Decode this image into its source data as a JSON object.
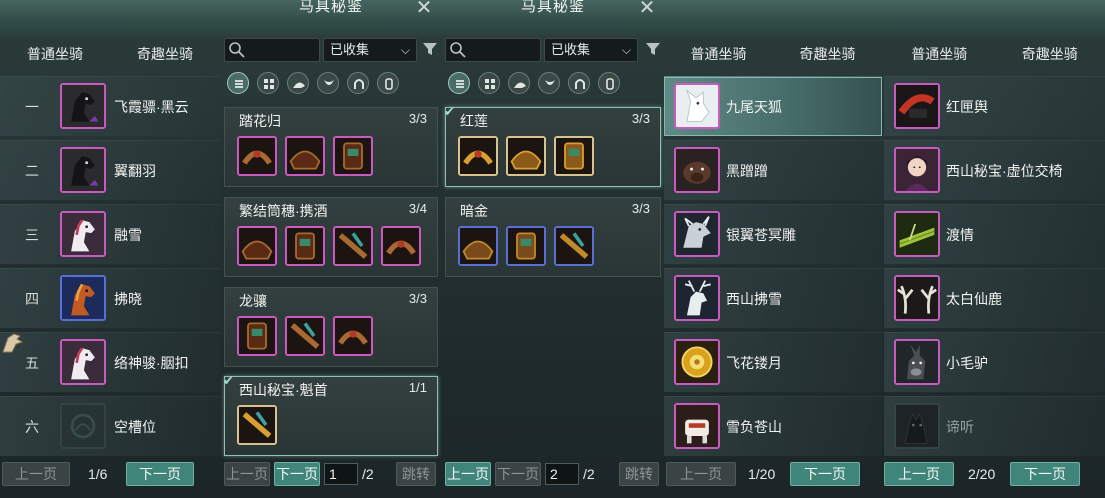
{
  "colors": {
    "accent": "#3f8579",
    "purple_border": "#c95bc0",
    "blue_border": "#5a6fd6",
    "selected_row": "#5f8a86"
  },
  "left_mount_panel": {
    "tabs": [
      "普通坐骑",
      "奇趣坐骑"
    ],
    "rows": [
      {
        "num": "一",
        "name": "飞霞骠·黑云",
        "icon": "black-horse-icon",
        "border": "purple"
      },
      {
        "num": "二",
        "name": "翼翻羽",
        "icon": "black-horse-icon",
        "border": "purple"
      },
      {
        "num": "三",
        "name": "融雪",
        "icon": "white-horse-icon",
        "border": "purple"
      },
      {
        "num": "四",
        "name": "拂晓",
        "icon": "red-horse-icon",
        "border": "blue"
      },
      {
        "num": "五",
        "name": "络神骏·胭扣",
        "icon": "white-horse-icon",
        "border": "purple"
      },
      {
        "num": "六",
        "name": "空槽位",
        "icon": "empty-slot-icon",
        "border": "empty"
      }
    ],
    "pager": {
      "prev": "上一页",
      "page": "1/6",
      "next": "下一页"
    }
  },
  "atlas_panels": [
    {
      "title": "马具秘鉴",
      "filter_value": "已收集",
      "sets": [
        {
          "name": "踏花归",
          "count": "3/3",
          "pieces": [
            "purple",
            "purple",
            "purple"
          ],
          "checked": false,
          "highlighted": false
        },
        {
          "name": "繁结筒穗·携酒",
          "count": "3/4",
          "pieces": [
            "purple",
            "purple",
            "purple",
            "purple"
          ],
          "checked": false,
          "highlighted": false
        },
        {
          "name": "龙骧",
          "count": "3/3",
          "pieces": [
            "purple",
            "purple",
            "purple"
          ],
          "checked": false,
          "highlighted": false
        },
        {
          "name": "西山秘宝·魁首",
          "count": "1/1",
          "pieces": [
            "gold"
          ],
          "checked": true,
          "highlighted": true
        }
      ],
      "pager": {
        "prev": "上一页",
        "next": "下一页",
        "page_input": "1",
        "total": "/2",
        "jump": "跳转"
      }
    },
    {
      "title": "马具秘鉴",
      "filter_value": "已收集",
      "sets": [
        {
          "name": "红莲",
          "count": "3/3",
          "pieces": [
            "gold",
            "gold",
            "gold"
          ],
          "checked": true,
          "highlighted": true
        },
        {
          "name": "暗金",
          "count": "3/3",
          "pieces": [
            "blue",
            "blue",
            "blue"
          ],
          "checked": false,
          "highlighted": false
        }
      ],
      "pager": {
        "prev": "上一页",
        "next": "下一页",
        "page_input": "2",
        "total": "/2",
        "jump": "跳转"
      }
    }
  ],
  "quirky_panel_1": {
    "tabs": [
      "普通坐骑",
      "奇趣坐骑"
    ],
    "rows": [
      {
        "name": "九尾天狐",
        "icon": "white-fox-icon",
        "selected": true
      },
      {
        "name": "黑蹭蹭",
        "icon": "black-boar-icon",
        "selected": false
      },
      {
        "name": "银翼苍冥雕",
        "icon": "silver-creature-icon",
        "selected": false
      },
      {
        "name": "西山拂雪",
        "icon": "white-deer-icon",
        "selected": false
      },
      {
        "name": "飞花镂月",
        "icon": "golden-disc-icon",
        "selected": false
      },
      {
        "name": "雪负苍山",
        "icon": "snow-beast-icon",
        "selected": false
      }
    ],
    "pager": {
      "prev": "上一页",
      "page": "1/20",
      "next": "下一页"
    }
  },
  "quirky_panel_2": {
    "tabs": [
      "普通坐骑",
      "奇趣坐骑"
    ],
    "rows": [
      {
        "name": "红匣舆",
        "icon": "red-box-icon",
        "dim": false
      },
      {
        "name": "西山秘宝·虚位交椅",
        "icon": "lady-portrait-icon",
        "dim": false
      },
      {
        "name": "渡情",
        "icon": "bamboo-raft-icon",
        "dim": false
      },
      {
        "name": "太白仙鹿",
        "icon": "antler-icon",
        "dim": false
      },
      {
        "name": "小毛驴",
        "icon": "donkey-icon",
        "dim": false
      },
      {
        "name": "谛听",
        "icon": "black-beast-icon",
        "dim": true
      }
    ],
    "pager": {
      "prev": "上一页",
      "page": "2/20",
      "next": "下一页"
    }
  }
}
